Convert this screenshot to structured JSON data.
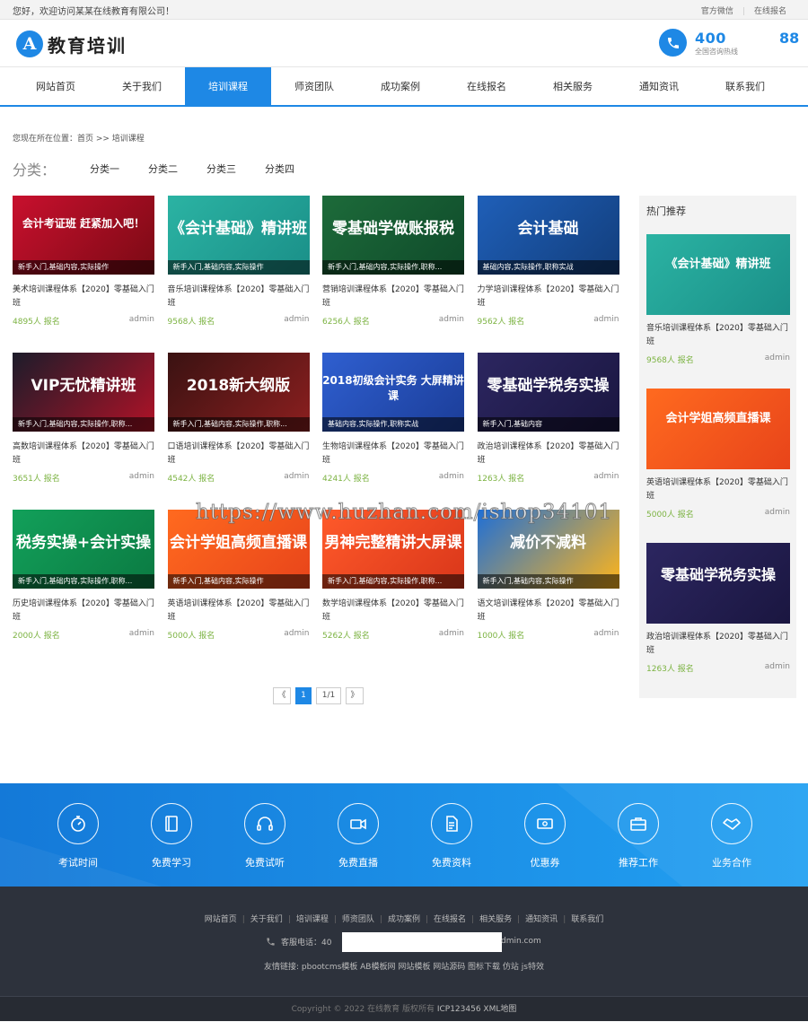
{
  "topbar": {
    "welcome": "您好，欢迎访问某某在线教育有限公司！",
    "links": [
      "官方微信",
      "在线报名"
    ]
  },
  "header": {
    "logo_badge": "A",
    "logo_text": "教育培训",
    "hotline_number": "400",
    "hotline_number_tail": "88",
    "hotline_label": "全国咨询热线"
  },
  "nav": {
    "items": [
      "网站首页",
      "关于我们",
      "培训课程",
      "师资团队",
      "成功案例",
      "在线报名",
      "相关服务",
      "通知资讯",
      "联系我们"
    ],
    "active": "培训课程"
  },
  "breadcrumb": "您现在所在位置：首页 >> 培训课程",
  "categories": {
    "label": "分类：",
    "items": [
      "分类一",
      "分类二",
      "分类三",
      "分类四"
    ]
  },
  "courses": [
    {
      "image_text": "会计考证班 赶紧加入吧！",
      "tag": "新手入门,基础内容,实际操作",
      "title": "美术培训课程体系【2020】零基础入门班",
      "count": "4895人 报名",
      "author": "admin",
      "colors": [
        "#c8102e",
        "#7a0a14"
      ]
    },
    {
      "image_text": "《会计基础》精讲班",
      "tag": "新手入门,基础内容,实际操作",
      "title": "音乐培训课程体系【2020】零基础入门班",
      "count": "9568人 报名",
      "author": "admin",
      "colors": [
        "#2bb3a3",
        "#1a8f88"
      ]
    },
    {
      "image_text": "零基础学做账报税",
      "tag": "新手入门,基础内容,实际操作,职称...",
      "title": "营销培训课程体系【2020】零基础入门班",
      "count": "6256人 报名",
      "author": "admin",
      "colors": [
        "#1d6b3a",
        "#0f4a2a"
      ]
    },
    {
      "image_text": "会计基础",
      "tag": "基础内容,实际操作,职称实战",
      "title": "力学培训课程体系【2020】零基础入门班",
      "count": "9562人 报名",
      "author": "admin",
      "colors": [
        "#1f5fb8",
        "#123e7c"
      ]
    },
    {
      "image_text": "VIP无忧精讲班",
      "tag": "新手入门,基础内容,实际操作,职称...",
      "title": "高数培训课程体系【2020】零基础入门班",
      "count": "3651人 报名",
      "author": "admin",
      "colors": [
        "#1c1c2a",
        "#b11227"
      ]
    },
    {
      "image_text": "2018新大纲版",
      "tag": "新手入门,基础内容,实际操作,职称...",
      "title": "口语培训课程体系【2020】零基础入门班",
      "count": "4542人 报名",
      "author": "admin",
      "colors": [
        "#3a1212",
        "#8c1f1f"
      ]
    },
    {
      "image_text": "2018初级会计实务 大屏精讲课",
      "tag": "基础内容,实际操作,职称实战",
      "title": "生物培训课程体系【2020】零基础入门班",
      "count": "4241人 报名",
      "author": "admin",
      "colors": [
        "#2f5fd0",
        "#1b3d98"
      ]
    },
    {
      "image_text": "零基础学税务实操",
      "tag": "新手入门,基础内容",
      "title": "政治培训课程体系【2020】零基础入门班",
      "count": "1263人 报名",
      "author": "admin",
      "colors": [
        "#2c2660",
        "#1a1640"
      ]
    },
    {
      "image_text": "税务实操+会计实操",
      "tag": "新手入门,基础内容,实际操作,职称...",
      "title": "历史培训课程体系【2020】零基础入门班",
      "count": "2000人 报名",
      "author": "admin",
      "colors": [
        "#12a05a",
        "#0b7a42"
      ]
    },
    {
      "image_text": "会计学姐高频直播课",
      "tag": "新手入门,基础内容,实际操作",
      "title": "英语培训课程体系【2020】零基础入门班",
      "count": "5000人 报名",
      "author": "admin",
      "colors": [
        "#ff6a1f",
        "#e8441a"
      ]
    },
    {
      "image_text": "男神完整精讲大屏课",
      "tag": "新手入门,基础内容,实际操作,职称...",
      "title": "数学培训课程体系【2020】零基础入门班",
      "count": "5262人 报名",
      "author": "admin",
      "colors": [
        "#ff5a2a",
        "#d9361a"
      ]
    },
    {
      "image_text": "减价不减料",
      "tag": "新手入门,基础内容,实际操作",
      "title": "语文培训课程体系【2020】零基础入门班",
      "count": "1000人 报名",
      "author": "admin",
      "colors": [
        "#1f6fd6",
        "#ffb51a"
      ]
    }
  ],
  "pagination": {
    "prev": "《",
    "current": "1",
    "total": "1/1",
    "next": "》"
  },
  "sidebar": {
    "title": "热门推荐",
    "items": [
      {
        "image_text": "《会计基础》精讲班",
        "title": "音乐培训课程体系【2020】零基础入门班",
        "count": "9568人 报名",
        "author": "admin",
        "colors": [
          "#2bb3a3",
          "#1a8f88"
        ]
      },
      {
        "image_text": "会计学姐高频直播课",
        "title": "英语培训课程体系【2020】零基础入门班",
        "count": "5000人 报名",
        "author": "admin",
        "colors": [
          "#ff6a1f",
          "#e8441a"
        ]
      },
      {
        "image_text": "零基础学税务实操",
        "title": "政治培训课程体系【2020】零基础入门班",
        "count": "1263人 报名",
        "author": "admin",
        "colors": [
          "#2c2660",
          "#1a1640"
        ]
      }
    ]
  },
  "watermark": "https://www.huzhan.com/ishop34101",
  "features": [
    {
      "label": "考试时间",
      "icon": "stopwatch-icon"
    },
    {
      "label": "免费学习",
      "icon": "book-icon"
    },
    {
      "label": "免费试听",
      "icon": "headset-icon"
    },
    {
      "label": "免费直播",
      "icon": "video-icon"
    },
    {
      "label": "免费资料",
      "icon": "document-icon"
    },
    {
      "label": "优惠券",
      "icon": "coupon-icon"
    },
    {
      "label": "推荐工作",
      "icon": "briefcase-icon"
    },
    {
      "label": "业务合作",
      "icon": "handshake-icon"
    }
  ],
  "footer": {
    "links": [
      "网站首页",
      "关于我们",
      "培训课程",
      "师资团队",
      "成功案例",
      "在线报名",
      "相关服务",
      "通知资讯",
      "联系我们"
    ],
    "phone_label": "客服电话：40",
    "email_tail": "dmin.com",
    "friends": "友情链接: pbootcms模板 AB模板网 网站模板 网站源码 图标下载 仿站 js特效",
    "copyright": "Copyright © 2022 在线教育 版权所有",
    "icp": "ICP123456 XML地图"
  },
  "colors": {
    "brand": "#1e88e5",
    "count": "#7cb342",
    "footer_bg": "#2d323c"
  }
}
